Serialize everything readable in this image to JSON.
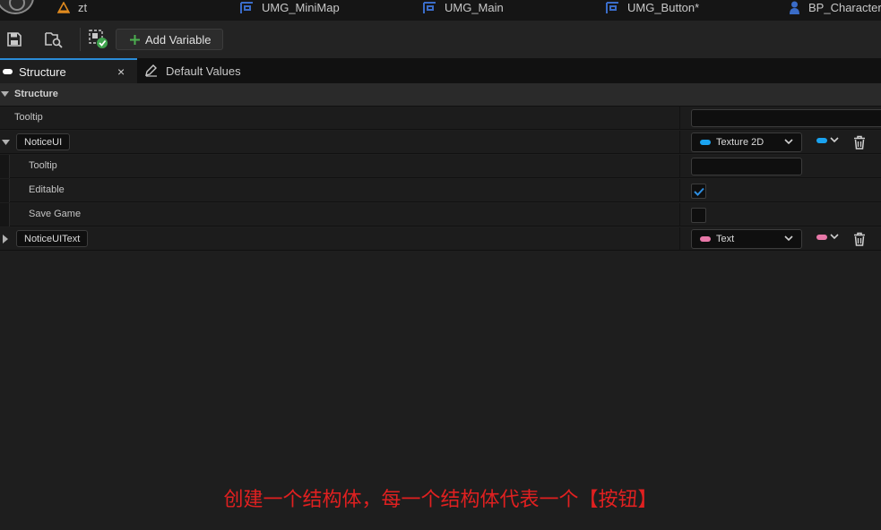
{
  "doc_tabs": [
    {
      "label": "zt",
      "icon": "warning-triangle-icon",
      "color": "#e08a1e"
    },
    {
      "label": "UMG_MiniMap",
      "icon": "widget-blueprint-icon",
      "color": "#3a6cc8"
    },
    {
      "label": "UMG_Main",
      "icon": "widget-blueprint-icon",
      "color": "#3a6cc8"
    },
    {
      "label": "UMG_Button*",
      "icon": "widget-blueprint-icon",
      "color": "#3a6cc8"
    },
    {
      "label": "BP_Character",
      "icon": "character-icon",
      "color": "#3a6cc8"
    }
  ],
  "toolbar": {
    "add_variable_label": "Add Variable",
    "add_icon_color": "#4caf50"
  },
  "panel_tabs": {
    "structure": "Structure",
    "default_values": "Default Values",
    "close_glyph": "×"
  },
  "section_header": "Structure",
  "rows": {
    "struct_tooltip_label": "Tooltip",
    "var1": {
      "name": "NoticeUI",
      "type": "Texture 2D",
      "type_color": "#1aa3f0",
      "tooltip_label": "Tooltip",
      "editable_label": "Editable",
      "editable_checked": true,
      "save_game_label": "Save Game",
      "save_game_checked": false
    },
    "var2": {
      "name": "NoticeUIText",
      "type": "Text",
      "type_color": "#e878a8"
    }
  },
  "caption": "创建一个结构体，每一个结构体代表一个【按钮】"
}
